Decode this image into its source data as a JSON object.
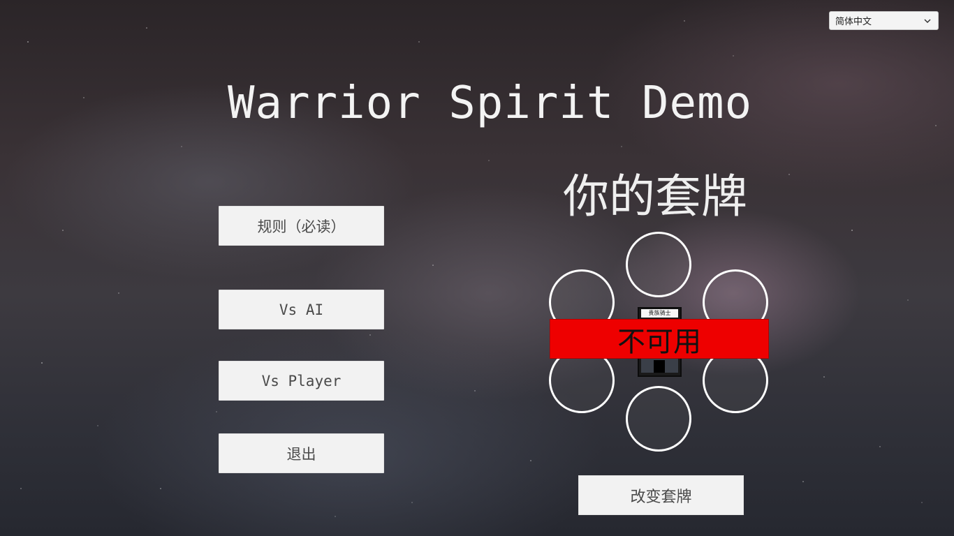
{
  "language_select": {
    "value": "简体中文",
    "icon": "chevron-down-icon"
  },
  "title": "Warrior Spirit Demo",
  "menu": {
    "rules": "规则（必读）",
    "vs_ai": "Vs AI",
    "vs_player": "Vs Player",
    "quit": "退出"
  },
  "deck": {
    "title": "你的套牌",
    "card_name": "贵族骑士",
    "status": "不可用",
    "change_button": "改变套牌"
  },
  "colors": {
    "status_red": "#ee0000",
    "button_bg": "#f2f2f2",
    "text_white": "#f3f3f3"
  }
}
